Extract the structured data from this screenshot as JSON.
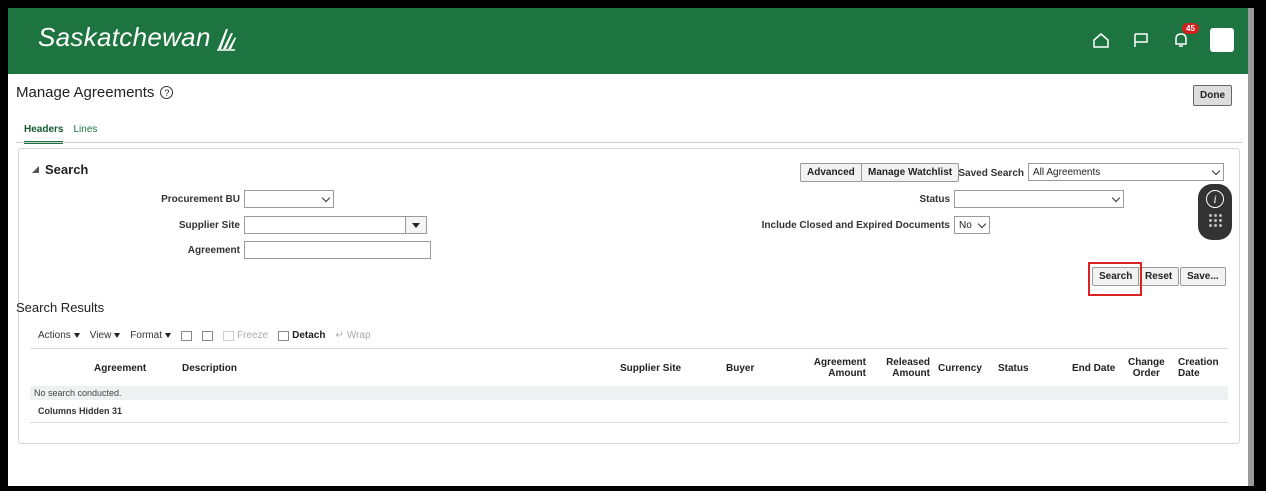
{
  "header": {
    "brand": "Saskatchewan",
    "notification_count": "45",
    "colors": {
      "banner": "#1d7441",
      "badge": "#d0201f"
    },
    "icons": [
      "home-icon",
      "flag-icon",
      "bell-icon",
      "user-avatar"
    ]
  },
  "page": {
    "title": "Manage Agreements",
    "help_glyph": "?",
    "done_label": "Done"
  },
  "tabs": [
    {
      "label": "Headers",
      "active": true
    },
    {
      "label": "Lines",
      "active": false
    }
  ],
  "search": {
    "title": "Search",
    "advanced_label": "Advanced",
    "manage_watchlist_label": "Manage Watchlist",
    "saved_search_label": "Saved Search",
    "saved_search_value": "All Agreements",
    "fields": {
      "procurement_bu": {
        "label": "Procurement BU",
        "value": ""
      },
      "supplier_site": {
        "label": "Supplier Site",
        "value": ""
      },
      "agreement": {
        "label": "Agreement",
        "value": ""
      },
      "status": {
        "label": "Status",
        "value": ""
      },
      "include_closed": {
        "label": "Include Closed and Expired Documents",
        "value": "No"
      }
    },
    "buttons": {
      "search": "Search",
      "reset": "Reset",
      "save": "Save..."
    }
  },
  "results": {
    "title": "Search Results",
    "toolbar": {
      "actions": "Actions",
      "view": "View",
      "format": "Format",
      "freeze": "Freeze",
      "detach": "Detach",
      "wrap": "Wrap"
    },
    "columns": {
      "agreement": "Agreement",
      "description": "Description",
      "supplier_site": "Supplier Site",
      "buyer": "Buyer",
      "agreement_amount_1": "Agreement",
      "agreement_amount_2": "Amount",
      "released_amount_1": "Released",
      "released_amount_2": "Amount",
      "currency": "Currency",
      "status": "Status",
      "end_date": "End Date",
      "change_order_1": "Change",
      "change_order_2": "Order",
      "creation_date_1": "Creation",
      "creation_date_2": "Date"
    },
    "empty_message": "No search conducted.",
    "columns_hidden_label": "Columns Hidden",
    "columns_hidden_count": "31"
  }
}
